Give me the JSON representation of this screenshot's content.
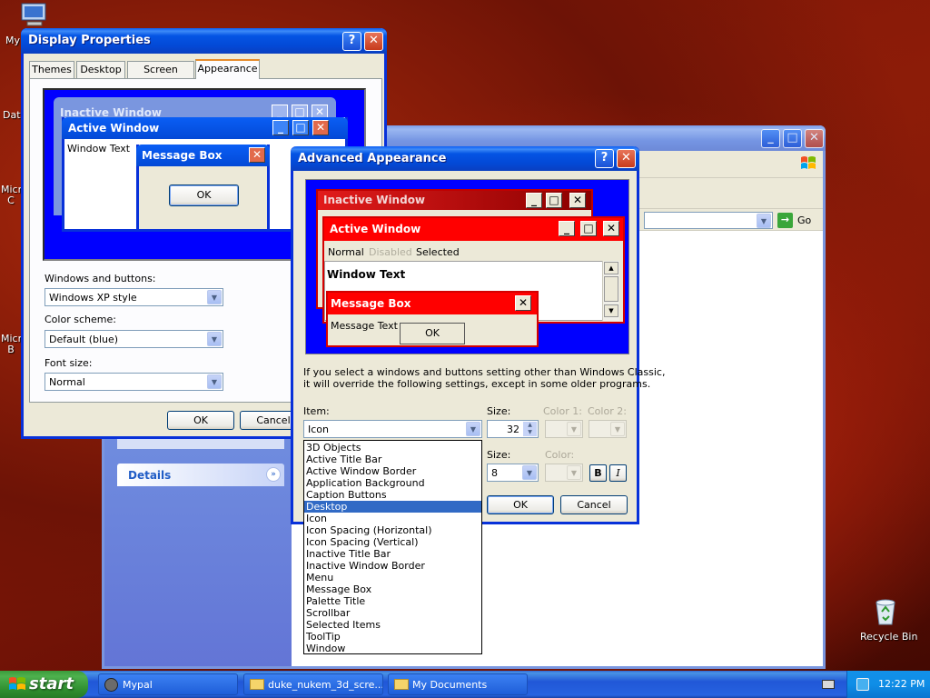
{
  "desktop": {
    "icons": [
      {
        "label": "My",
        "icon": "my-computer-icon"
      },
      {
        "label": "Dat",
        "icon": "folder-icon"
      },
      {
        "label": "Micro C",
        "icon": "app-icon"
      },
      {
        "label": "Micro B",
        "icon": "app-icon"
      },
      {
        "label": "Recycle Bin",
        "icon": "recycle-bin-icon"
      }
    ]
  },
  "explorer": {
    "go_label": "Go",
    "details_label": "Details"
  },
  "display_props": {
    "title": "Display Properties",
    "tabs": [
      "Themes",
      "Desktop",
      "Screen Saver",
      "Appearance"
    ],
    "active_tab": "Appearance",
    "preview": {
      "inactive_title": "Inactive Window",
      "active_title": "Active Window",
      "window_text": "Window Text",
      "message_title": "Message Box",
      "ok": "OK"
    },
    "windows_buttons_label": "Windows and buttons:",
    "windows_buttons_value": "Windows XP style",
    "color_scheme_label": "Color scheme:",
    "color_scheme_value": "Default (blue)",
    "font_size_label": "Font size:",
    "font_size_value": "Normal",
    "ok": "OK",
    "cancel": "Cancel"
  },
  "advanced": {
    "title": "Advanced Appearance",
    "preview": {
      "inactive_title": "Inactive Window",
      "active_title": "Active Window",
      "menu_normal": "Normal",
      "menu_disabled": "Disabled",
      "menu_selected": "Selected",
      "window_text": "Window Text",
      "message_title": "Message Box",
      "message_text": "Message Text",
      "ok": "OK"
    },
    "info_line1": "If you select a windows and buttons setting other than Windows Classic,",
    "info_line2": "it will override the following settings, except in some older programs.",
    "item_label": "Item:",
    "item_value": "Icon",
    "size_label": "Size:",
    "size_value": "32",
    "color1_label": "Color 1:",
    "color2_label": "Color 2:",
    "font_size_label": "Size:",
    "font_size_value": "8",
    "font_color_label": "Color:",
    "bold": "B",
    "italic": "I",
    "ok": "OK",
    "cancel": "Cancel",
    "items": [
      "3D Objects",
      "Active Title Bar",
      "Active Window Border",
      "Application Background",
      "Caption Buttons",
      "Desktop",
      "Icon",
      "Icon Spacing (Horizontal)",
      "Icon Spacing (Vertical)",
      "Inactive Title Bar",
      "Inactive Window Border",
      "Menu",
      "Message Box",
      "Palette Title",
      "Scrollbar",
      "Selected Items",
      "ToolTip",
      "Window"
    ],
    "selected_item": "Desktop"
  },
  "taskbar": {
    "start": "start",
    "tasks": [
      "Mypal",
      "duke_nukem_3d_scre...",
      "My Documents"
    ],
    "clock": "12:22 PM"
  },
  "colors": {
    "xp_blue": "#0831d9",
    "preview_blue": "#0000ff",
    "preview_red": "#ff0000",
    "selection": "#316ac5"
  }
}
